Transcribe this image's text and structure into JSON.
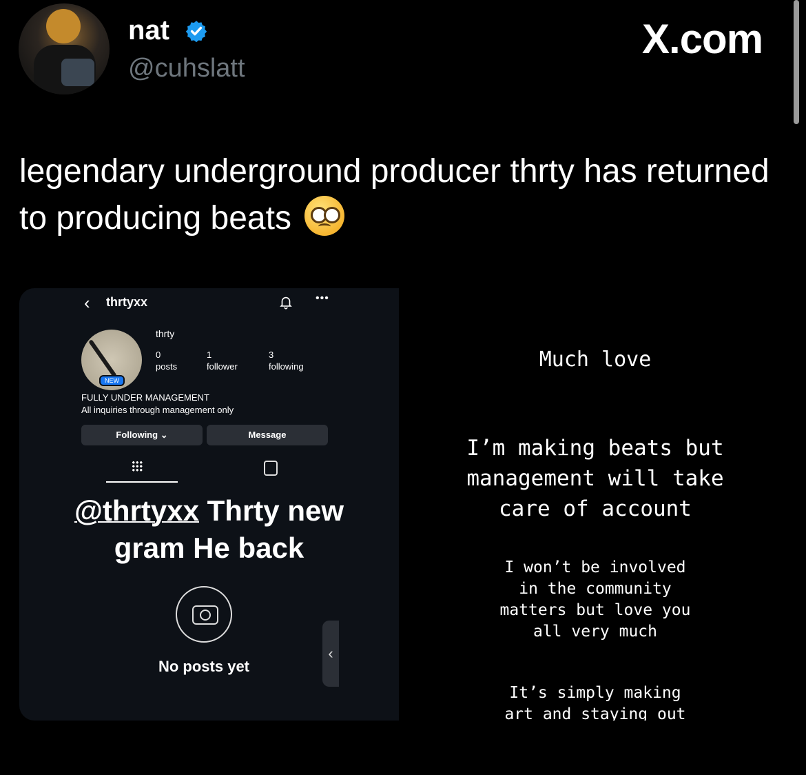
{
  "tweet": {
    "author_name": "nat",
    "author_handle": "@cuhslatt",
    "site": "X.com",
    "text": "legendary underground producer thrty has returned to producing beats",
    "emoji": "pleading-face-with-tears",
    "brand_color": "#1d9bf0"
  },
  "left_screenshot": {
    "username": "thrtyxx",
    "display_name": "thrty",
    "new_badge": "NEW",
    "stats": [
      {
        "count": "0",
        "label": "posts"
      },
      {
        "count": "1",
        "label": "follower"
      },
      {
        "count": "3",
        "label": "following"
      }
    ],
    "bio_line1": "FULLY UNDER MANAGEMENT",
    "bio_line2": "All inquiries through management only",
    "following_button": "Following",
    "message_button": "Message",
    "caption_handle": "@thrtyxx",
    "caption_rest": "Thrty new",
    "caption_line2": "gram He back",
    "empty_state": "No posts yet"
  },
  "right_screenshot": {
    "line1": "Much love",
    "block2": [
      "I’m making beats but",
      "management will take",
      "care of account"
    ],
    "block3": [
      "I won’t be involved",
      "in the community",
      "matters but love you",
      "all very much"
    ],
    "block4": [
      "It’s simply making",
      "art and staying out"
    ]
  }
}
